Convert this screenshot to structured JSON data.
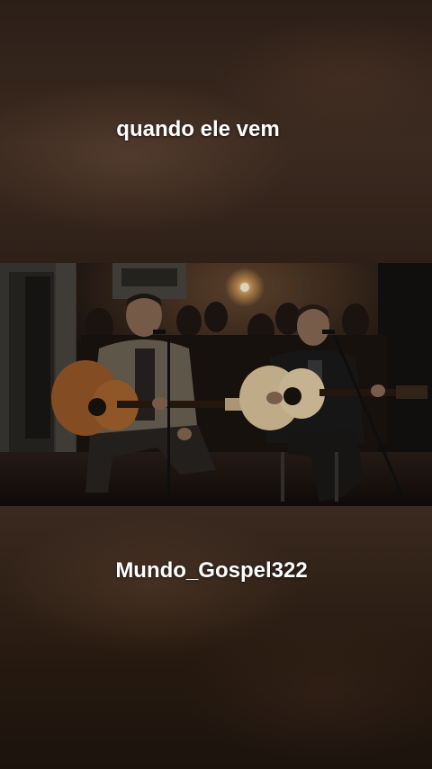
{
  "captions": {
    "top": "quando ele vem",
    "bottom": "Mundo_Gospel322"
  },
  "video": {
    "description_icon": "video-frame-icon"
  },
  "colors": {
    "caption": "#ffffff",
    "background": "#2a1c14"
  }
}
